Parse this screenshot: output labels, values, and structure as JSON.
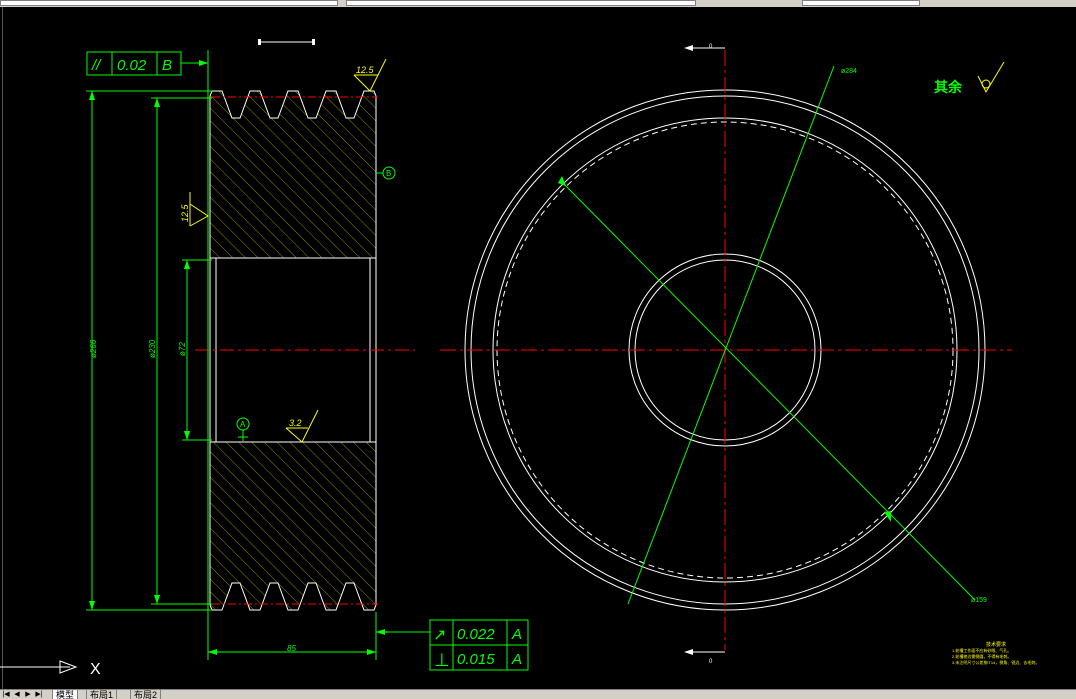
{
  "drawing": {
    "flatness_tolerance": {
      "symbol": "//",
      "value": "0.02",
      "datum": "B"
    },
    "runout_tolerance": {
      "symbol": "↗",
      "value": "0.022",
      "datum": "A"
    },
    "perpendicularity_tolerance": {
      "symbol": "⊥",
      "value": "0.015",
      "datum": "A"
    },
    "roughness_top": "12.5",
    "roughness_side": "12.5",
    "roughness_bore": "3.2",
    "datum_b": "B",
    "datum_a": "A",
    "dim_outer_dia": "ø266",
    "dim_root_dia": "ø230",
    "dim_bore_dia": "ø72",
    "dim_width": "85",
    "dim_leader_top": "ø284",
    "dim_leader_bottom": "ø159",
    "section_mark_top": "0",
    "section_mark_bottom": "0",
    "remaining_roughness": "其余",
    "notes_title": "技术要求",
    "notes_lines": [
      "1.轮槽工作面不应有砂眼、气孔。",
      "2.轮槽棱边需倒圆，不得有毛刺。",
      "3.未注明尺寸公差按IT14，倒角、锐边、去毛刺。"
    ]
  },
  "ucs_icon": {
    "axis_label": "X"
  },
  "tabs": [
    {
      "label": "模型",
      "active": true
    },
    {
      "label": "布局1",
      "active": false
    },
    {
      "label": "布局2",
      "active": false
    }
  ],
  "colors": {
    "background": "#000000",
    "outline": "#ffffff",
    "dimension": "#00ff00",
    "centerline": "#ff0000",
    "hatch": "#c8c800",
    "text": "#ffff00"
  }
}
